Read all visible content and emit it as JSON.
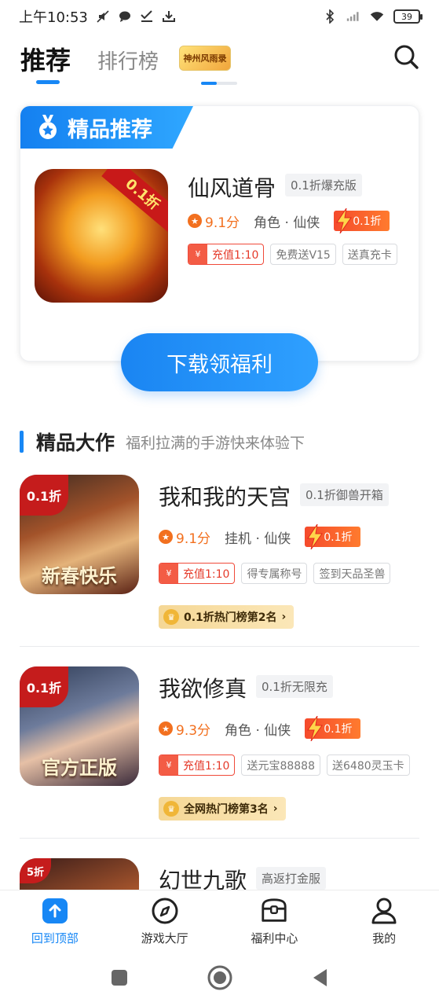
{
  "status_bar": {
    "time": "上午10:53",
    "battery": "39",
    "icons": [
      "mute-icon",
      "chat-bubble-icon",
      "check-icon",
      "download-icon",
      "bluetooth-icon",
      "signal-icon",
      "wifi-icon"
    ]
  },
  "tabs": {
    "recommend": "推荐",
    "rank": "排行榜",
    "logo_text": "神州风雨录"
  },
  "featured": {
    "banner": "精品推荐",
    "icon_ribbon": "0.1折",
    "name": "仙风道骨",
    "version": "0.1折爆充版",
    "rating": "9.1分",
    "genre": "角色 · 仙侠",
    "discount": "0.1折",
    "tags": [
      "充值1:10",
      "免费送V15",
      "送真充卡"
    ],
    "download": "下载领福利"
  },
  "section": {
    "title": "精品大作",
    "subtitle": "福利拉满的手游快来体验下"
  },
  "games": [
    {
      "corner": "0.1折",
      "cover_text": "新春快乐",
      "name": "我和我的天宫",
      "version": "0.1折御兽开箱",
      "rating": "9.1分",
      "genre": "挂机 · 仙侠",
      "discount": "0.1折",
      "tags": [
        "充值1:10",
        "得专属称号",
        "签到天品圣兽"
      ],
      "rank": "0.1折热门榜第2名"
    },
    {
      "corner": "0.1折",
      "cover_text": "官方正版",
      "name": "我欲修真",
      "version": "0.1折无限充",
      "rating": "9.3分",
      "genre": "角色 · 仙侠",
      "discount": "0.1折",
      "tags": [
        "充值1:10",
        "送元宝88888",
        "送6480灵玉卡"
      ],
      "rank": "全网热门榜第3名"
    },
    {
      "corner": "5折",
      "name": "幻世九歌",
      "version": "高返打金服"
    }
  ],
  "bottom_nav": [
    {
      "label": "回到顶部",
      "icon": "arrow-up-icon"
    },
    {
      "label": "游戏大厅",
      "icon": "compass-icon"
    },
    {
      "label": "福利中心",
      "icon": "treasure-chest-icon"
    },
    {
      "label": "我的",
      "icon": "user-icon"
    }
  ],
  "colors": {
    "accent": "#1787f5",
    "rating": "#f2701f",
    "discount": "#f54a2c"
  }
}
